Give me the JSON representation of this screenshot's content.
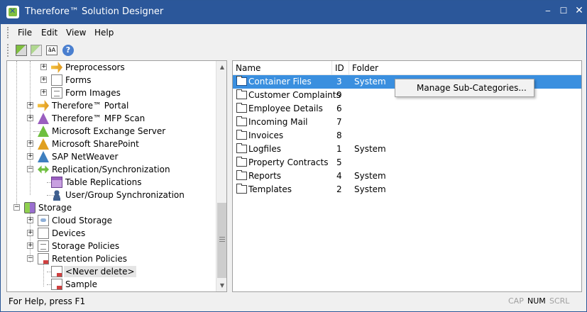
{
  "window": {
    "title": "Therefore™ Solution Designer",
    "minimize_glyph": "‒",
    "maximize_glyph": "☐",
    "close_glyph": "✕"
  },
  "menu": [
    "File",
    "Edit",
    "View",
    "Help"
  ],
  "toolbar": {
    "buttons": [
      "categories-icon",
      "categories-disabled-icon",
      "label-icon",
      "help-icon"
    ],
    "label_icon_text": "āA",
    "help_glyph": "?"
  },
  "tree": {
    "nodes": [
      {
        "label": "Preprocessors",
        "icon": "preprocessor-icon",
        "expander": "+"
      },
      {
        "label": "Forms",
        "icon": "form-icon",
        "expander": "+"
      },
      {
        "label": "Form Images",
        "icon": "form-image-icon",
        "expander": "+"
      },
      {
        "label": "Therefore™ Portal",
        "icon": "portal-icon",
        "expander": "+"
      },
      {
        "label": "Therefore™ MFP Scan",
        "icon": "mfp-scan-icon",
        "expander": "+"
      },
      {
        "label": "Microsoft Exchange Server",
        "icon": "exchange-icon",
        "expander": ""
      },
      {
        "label": "Microsoft SharePoint",
        "icon": "sharepoint-icon",
        "expander": "+"
      },
      {
        "label": "SAP NetWeaver",
        "icon": "sap-icon",
        "expander": "+"
      },
      {
        "label": "Replication/Synchronization",
        "icon": "replication-icon",
        "expander": "−"
      },
      {
        "label": "Table Replications",
        "icon": "table-replication-icon",
        "expander": ""
      },
      {
        "label": "User/Group Synchronization",
        "icon": "user-sync-icon",
        "expander": ""
      },
      {
        "label": "Storage",
        "icon": "storage-icon",
        "expander": "−"
      },
      {
        "label": "Cloud Storage",
        "icon": "cloud-storage-icon",
        "expander": "+"
      },
      {
        "label": "Devices",
        "icon": "devices-icon",
        "expander": "+"
      },
      {
        "label": "Storage Policies",
        "icon": "storage-policy-icon",
        "expander": "+"
      },
      {
        "label": "Retention Policies",
        "icon": "retention-policy-icon",
        "expander": "−"
      },
      {
        "label": "<Never delete>",
        "icon": "retention-item-icon",
        "expander": ""
      },
      {
        "label": "Sample",
        "icon": "retention-item-icon",
        "expander": ""
      }
    ],
    "scroll_up_glyph": "▲",
    "scroll_down_glyph": "▼"
  },
  "list": {
    "columns": [
      "Name",
      "ID",
      "Folder"
    ],
    "rows": [
      {
        "name": "Container Files",
        "id": "3",
        "folder": "System"
      },
      {
        "name": "Customer Complaints",
        "id": "9",
        "folder": ""
      },
      {
        "name": "Employee Details",
        "id": "6",
        "folder": ""
      },
      {
        "name": "Incoming Mail",
        "id": "7",
        "folder": ""
      },
      {
        "name": "Invoices",
        "id": "8",
        "folder": ""
      },
      {
        "name": "Logfiles",
        "id": "1",
        "folder": "System"
      },
      {
        "name": "Property Contracts",
        "id": "5",
        "folder": ""
      },
      {
        "name": "Reports",
        "id": "4",
        "folder": "System"
      },
      {
        "name": "Templates",
        "id": "2",
        "folder": "System"
      }
    ],
    "selected_index": 0
  },
  "context_menu": {
    "items": [
      "Manage Sub-Categories..."
    ]
  },
  "status": {
    "text": "For Help, press F1",
    "indicators": [
      {
        "label": "CAP",
        "active": false
      },
      {
        "label": "NUM",
        "active": true
      },
      {
        "label": "SCRL",
        "active": false
      }
    ]
  }
}
